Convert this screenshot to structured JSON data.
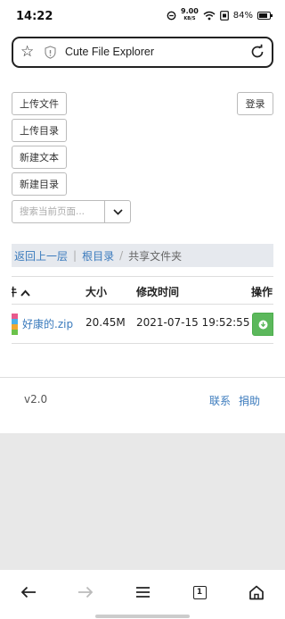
{
  "status_bar": {
    "time": "14:22",
    "net_speed_value": "9.00",
    "net_speed_unit": "KB/S",
    "battery_percent": "84%",
    "battery_level": 0.84
  },
  "browser": {
    "page_title": "Cute File Explorer"
  },
  "toolbar": {
    "upload_file": "上传文件",
    "upload_dir": "上传目录",
    "new_text": "新建文本",
    "new_dir": "新建目录",
    "login": "登录",
    "search_placeholder": "搜索当前页面..."
  },
  "breadcrumb": {
    "back": "返回上一层",
    "root": "根目录",
    "current": "共享文件夹",
    "separator1": "|",
    "separator2": "/"
  },
  "table": {
    "headers": {
      "name": "件",
      "size": "大小",
      "modified": "修改时间",
      "actions": "操作"
    },
    "rows": [
      {
        "name": "好康的.zip",
        "size": "20.45M",
        "modified": "2021-07-15 19:52:55"
      }
    ]
  },
  "footer": {
    "version": "v2.0",
    "contact": "联系",
    "donate": "捐助"
  },
  "colors": {
    "link": "#3b7bbd",
    "download_button": "#5cb85c",
    "breadcrumb_bg": "#e6e9ee",
    "file_icon_stripes": [
      "#e85a8c",
      "#4ab0e8",
      "#f0a830",
      "#6cc24a"
    ]
  },
  "icons": {
    "bookmark": "star-icon",
    "security": "shield-info-icon",
    "reload": "reload-icon",
    "dropdown": "chevron-down-icon",
    "sort": "sort-up-icon",
    "download": "download-circle-icon",
    "nav": [
      "back-arrow-icon",
      "forward-arrow-icon",
      "menu-icon",
      "tabs-icon",
      "home-icon"
    ]
  },
  "bottom_nav": {
    "tab_count": "1"
  }
}
